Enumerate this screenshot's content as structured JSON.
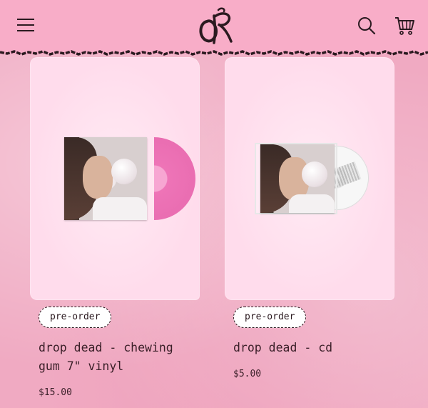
{
  "header": {
    "logo_text": "OR",
    "menu_icon": "hamburger-menu-icon",
    "search_icon": "search-icon",
    "cart_icon": "shopping-cart-icon",
    "background": "#f8adc8"
  },
  "products": [
    {
      "badge": "pre-order",
      "title_line1": "drop dead - chewing",
      "title_line2": "gum 7\" vinyl",
      "price": "$15.00",
      "media": "vinyl"
    },
    {
      "badge": "pre-order",
      "title_line1": "drop dead - cd",
      "title_line2": "",
      "price": "$5.00",
      "media": "cd"
    }
  ],
  "colors": {
    "page_background": "#f0aac2",
    "card_background": "#ffd8ea",
    "vinyl_pink": "#ee74b7",
    "text": "#3a1f28"
  }
}
